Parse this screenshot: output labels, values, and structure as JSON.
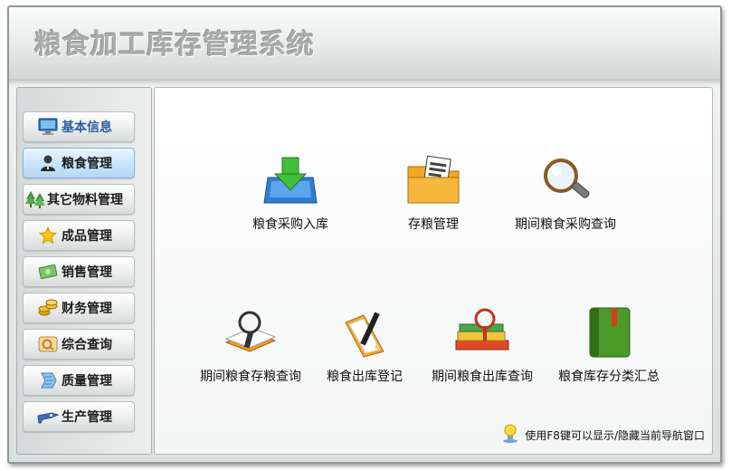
{
  "app": {
    "title": "粮食加工库存管理系统"
  },
  "sidebar": {
    "items": [
      {
        "label": "基本信息",
        "icon": "monitor-icon",
        "active": false
      },
      {
        "label": "粮食管理",
        "icon": "user-icon",
        "active": true
      },
      {
        "label": "其它物料管理",
        "icon": "trees-icon",
        "active": false
      },
      {
        "label": "成品管理",
        "icon": "star-icon",
        "active": false
      },
      {
        "label": "销售管理",
        "icon": "banknote-icon",
        "active": false
      },
      {
        "label": "财务管理",
        "icon": "coins-icon",
        "active": false
      },
      {
        "label": "综合查询",
        "icon": "query-icon",
        "active": false
      },
      {
        "label": "质量管理",
        "icon": "quality-icon",
        "active": false
      },
      {
        "label": "生产管理",
        "icon": "production-icon",
        "active": false
      }
    ]
  },
  "main": {
    "functions": [
      {
        "label": "粮食采购入库",
        "icon": "inbox-download-icon"
      },
      {
        "label": "存粮管理",
        "icon": "folder-document-icon"
      },
      {
        "label": "期间粮食采购查询",
        "icon": "magnifier-icon"
      },
      {
        "label": "期间粮食存粮查询",
        "icon": "book-magnifier-icon"
      },
      {
        "label": "粮食出库登记",
        "icon": "folder-pen-icon"
      },
      {
        "label": "期间粮食出库查询",
        "icon": "books-magnifier-icon"
      },
      {
        "label": "粮食库存分类汇总",
        "icon": "green-book-icon"
      }
    ],
    "hint": "使用F8键可以显示/隐藏当前导航窗口"
  },
  "colors": {
    "accent": "#c7e3fb",
    "title_text": "#a9abab",
    "first_item_text": "#2a5d9a"
  }
}
